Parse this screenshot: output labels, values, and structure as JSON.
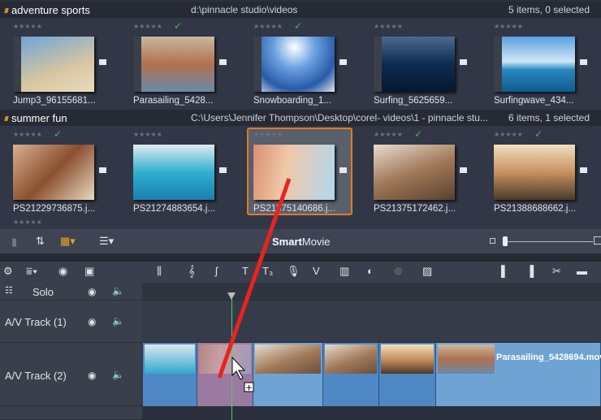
{
  "bins": [
    {
      "name": "adventure sports",
      "path": "d:\\pinnacle studio\\videos",
      "count": "5 items, 0 selected",
      "items": [
        {
          "label": "Jump3_96155681...",
          "checked": false
        },
        {
          "label": "Parasailing_5428...",
          "checked": true
        },
        {
          "label": "Snowboarding_1...",
          "checked": true
        },
        {
          "label": "Surfing_5625659...",
          "checked": false
        },
        {
          "label": "Surfingwave_434...",
          "checked": false
        }
      ]
    },
    {
      "name": "summer fun",
      "path": "C:\\Users\\Jennifer Thompson\\Desktop\\corel- videos\\1 - pinnacle stu...",
      "count": "6 items, 1 selected",
      "items": [
        {
          "label": "PS21229736875.j...",
          "checked": true
        },
        {
          "label": "PS21274883654.j...",
          "checked": false
        },
        {
          "label": "PS21375140686.j...",
          "checked": false,
          "selected": true
        },
        {
          "label": "PS21375172462.j...",
          "checked": true
        },
        {
          "label": "PS21388688662.j...",
          "checked": true
        }
      ]
    }
  ],
  "stars": "★★★★★",
  "check": "✓",
  "toolbar": {
    "smart_bold": "Smart",
    "smart_rest": "Movie"
  },
  "timeline": {
    "solo": "Solo",
    "tracks": [
      {
        "name": "A/V Track (1)"
      },
      {
        "name": "A/V Track (2)"
      }
    ],
    "clip_label": "Parasailing_5428694.mov"
  }
}
